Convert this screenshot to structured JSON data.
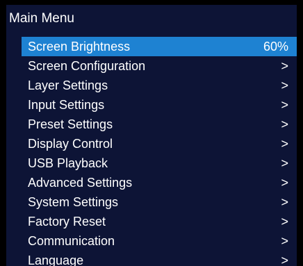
{
  "menu": {
    "title": "Main Menu",
    "items": [
      {
        "label": "Screen Brightness",
        "value": "60%",
        "selected": true
      },
      {
        "label": "Screen Configuration",
        "value": ">"
      },
      {
        "label": "Layer Settings",
        "value": ">"
      },
      {
        "label": "Input Settings",
        "value": ">"
      },
      {
        "label": "Preset Settings",
        "value": ">"
      },
      {
        "label": "Display Control",
        "value": ">"
      },
      {
        "label": "USB Playback",
        "value": ">"
      },
      {
        "label": "Advanced Settings",
        "value": ">"
      },
      {
        "label": "System Settings",
        "value": ">"
      },
      {
        "label": "Factory Reset",
        "value": ">"
      },
      {
        "label": "Communication",
        "value": ">"
      },
      {
        "label": "Language",
        "value": ">"
      }
    ]
  }
}
